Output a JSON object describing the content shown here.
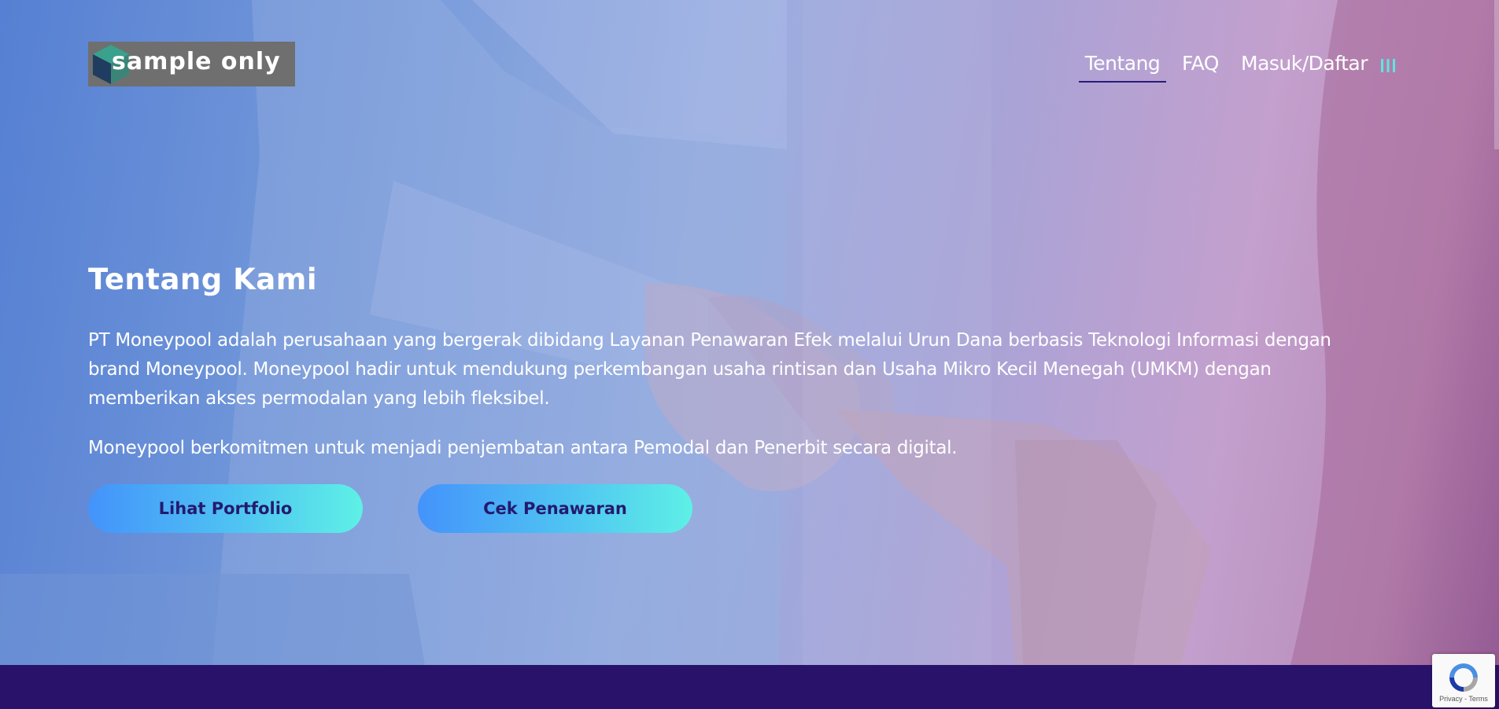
{
  "brand": {
    "logo_text": "sample only"
  },
  "nav": {
    "items": [
      {
        "label": "Tentang",
        "active": true
      },
      {
        "label": "FAQ"
      },
      {
        "label": "Masuk/Daftar"
      }
    ],
    "menu_icon": "bars-icon"
  },
  "hero": {
    "title": "Tentang Kami",
    "paragraph_1": "PT Moneypool adalah perusahaan yang bergerak dibidang Layanan Penawaran Efek melalui Urun Dana berbasis Teknologi Informasi dengan brand Moneypool. Moneypool hadir untuk mendukung perkembangan usaha rintisan dan Usaha Mikro Kecil Menegah (UMKM) dengan memberikan akses permodalan yang lebih fleksibel.",
    "paragraph_2": "Moneypool berkomitmen untuk menjadi penjembatan antara Pemodal dan Penerbit secara digital.",
    "buttons": {
      "portfolio": "Lihat Portfolio",
      "penawaran": "Cek Penawaran"
    }
  },
  "recaptcha": {
    "links": "Privacy - Terms"
  },
  "colors": {
    "footer_band": "#29126a",
    "button_gradient_start": "#4493fb",
    "button_gradient_end": "#5ef0e6",
    "button_text": "#241a6e",
    "nav_underline": "#2a1a78",
    "menu_icon": "#5ee6e0"
  }
}
